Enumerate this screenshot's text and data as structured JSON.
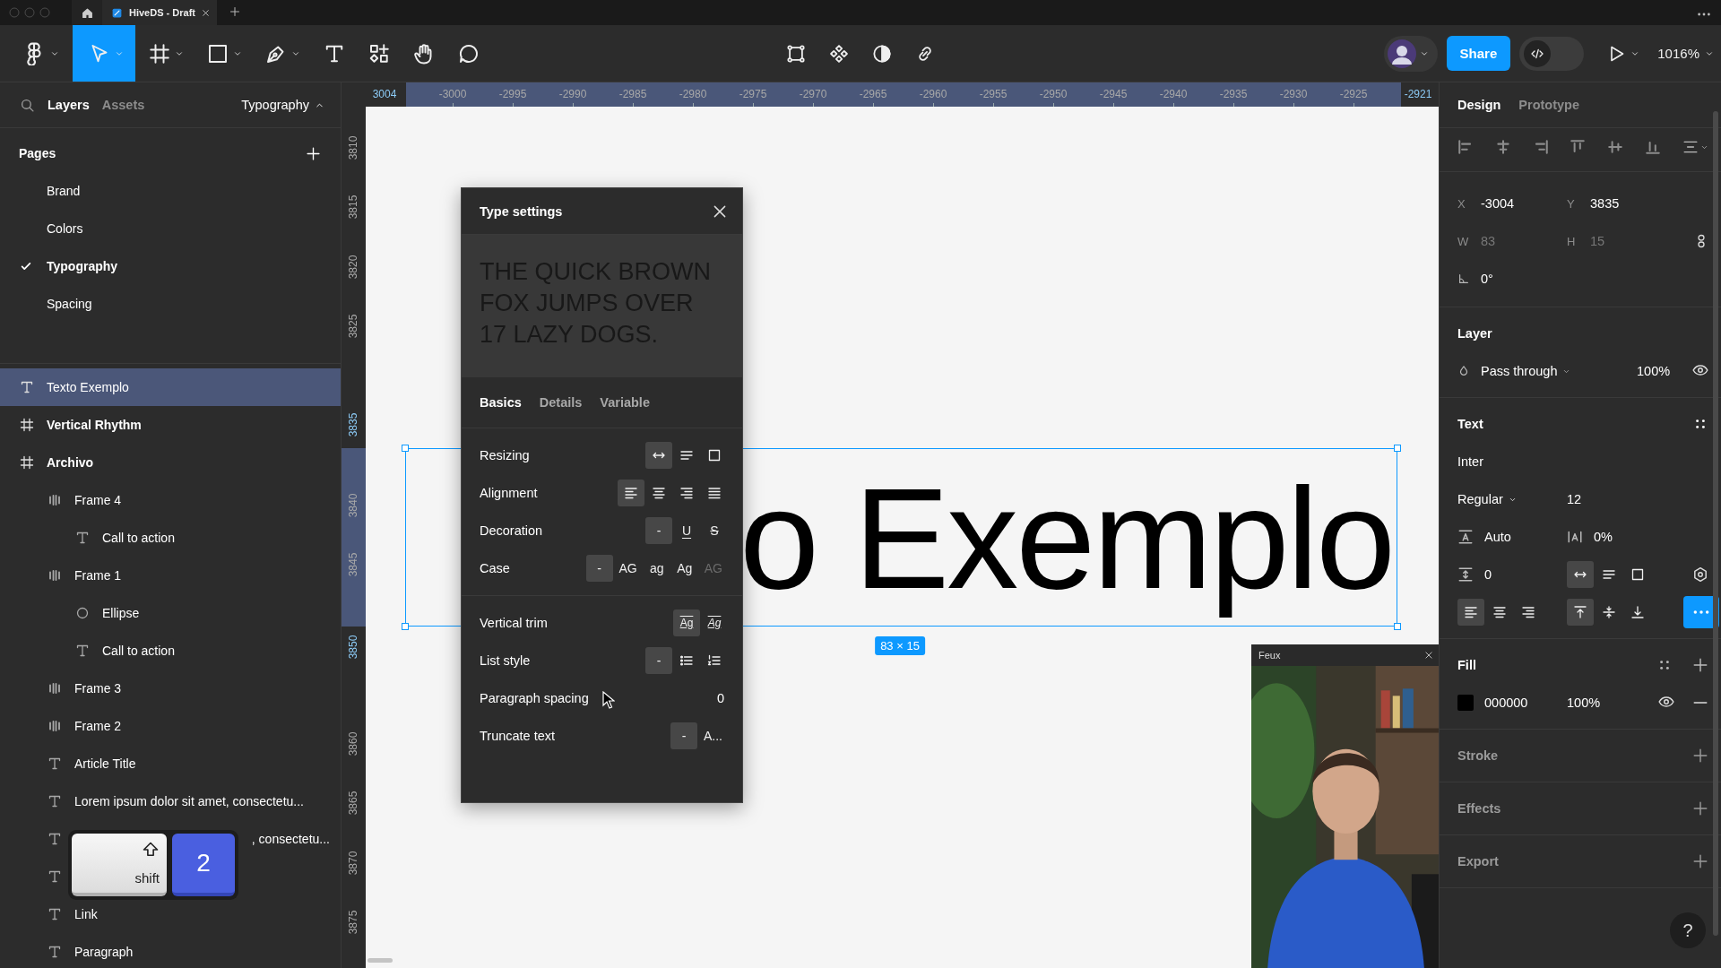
{
  "browser_tabs": [
    {
      "title": "HiveDS - Draft",
      "selected": true
    }
  ],
  "toolbar": {
    "tools": [
      {
        "kind": "figma",
        "selected": false
      },
      {
        "kind": "move",
        "selected": true
      },
      {
        "kind": "frame",
        "selected": false
      },
      {
        "kind": "shape",
        "selected": false
      },
      {
        "kind": "pen",
        "selected": false
      },
      {
        "kind": "text",
        "selected": false
      },
      {
        "kind": "actions",
        "selected": false
      },
      {
        "kind": "hand",
        "selected": false
      },
      {
        "kind": "comment",
        "selected": false
      }
    ],
    "center_tools": [
      {
        "kind": "transform"
      },
      {
        "kind": "component"
      },
      {
        "kind": "contrast"
      },
      {
        "kind": "link"
      }
    ],
    "share": "Share",
    "dev_mode_on": false,
    "zoom": "1016%"
  },
  "left_panel": {
    "tabs": [
      {
        "label": "Layers",
        "selected": true
      },
      {
        "label": "Assets",
        "selected": false
      }
    ],
    "page_picker": "Typography",
    "pages_title": "Pages",
    "pages": [
      {
        "name": "Brand",
        "selected": false
      },
      {
        "name": "Colors",
        "selected": false
      },
      {
        "name": "Typography",
        "selected": true
      },
      {
        "name": "Spacing",
        "selected": false
      }
    ],
    "layers": [
      {
        "name": "Texto Exemplo",
        "kind": "text",
        "selected": true,
        "covered": false
      },
      {
        "name": "Vertical Rhythm",
        "kind": "frame",
        "selected": false,
        "covered": false
      },
      {
        "name": "Archivo",
        "kind": "frame",
        "selected": false,
        "covered": false,
        "children": [
          {
            "name": "Frame 4",
            "kind": "autolayout",
            "selected": false,
            "covered": false,
            "children": [
              {
                "name": "Call to action",
                "kind": "text",
                "selected": false,
                "covered": false
              }
            ]
          },
          {
            "name": "Frame 1",
            "kind": "autolayout",
            "selected": false,
            "covered": false,
            "children": [
              {
                "name": "Ellipse",
                "kind": "ellipse",
                "selected": false,
                "covered": false
              },
              {
                "name": "Call to action",
                "kind": "text",
                "selected": false,
                "covered": false
              }
            ]
          },
          {
            "name": "Frame 3",
            "kind": "autolayout",
            "selected": false,
            "covered": false
          },
          {
            "name": "Frame 2",
            "kind": "autolayout",
            "selected": false,
            "covered": false
          },
          {
            "name": "Article Title",
            "kind": "text",
            "selected": false,
            "covered": false
          },
          {
            "name": "Lorem ipsum dolor sit amet, consectetu...",
            "kind": "text",
            "selected": false,
            "covered": false
          },
          {
            "name": ", consectetu...",
            "kind": "text",
            "selected": false,
            "covered": true
          },
          {
            "kind": "text",
            "selected": false
          },
          {
            "name": "Link",
            "kind": "text",
            "selected": false,
            "covered": false
          },
          {
            "name": "Paragraph",
            "kind": "text",
            "selected": false,
            "covered": false
          }
        ]
      }
    ]
  },
  "key_overlay": {
    "keys": [
      {
        "kind": "modifier",
        "label": "shift"
      },
      {
        "kind": "digit",
        "label": "2"
      }
    ]
  },
  "canvas": {
    "ruler_top": [
      {
        "label": "3004",
        "selected": true
      },
      {
        "label": "-3000",
        "selected": false
      },
      {
        "label": "-2995",
        "selected": false
      },
      {
        "label": "-2990",
        "selected": false
      },
      {
        "label": "-2985",
        "selected": false
      },
      {
        "label": "-2980",
        "selected": false
      },
      {
        "label": "-2975",
        "selected": false
      },
      {
        "label": "-2970",
        "selected": false
      },
      {
        "label": "-2965",
        "selected": false
      },
      {
        "label": "-2960",
        "selected": false
      },
      {
        "label": "-2955",
        "selected": false
      },
      {
        "label": "-2950",
        "selected": false
      },
      {
        "label": "-2945",
        "selected": false
      },
      {
        "label": "-2940",
        "selected": false
      },
      {
        "label": "-2935",
        "selected": false
      },
      {
        "label": "-2930",
        "selected": false
      },
      {
        "label": "-2925",
        "selected": false
      },
      {
        "label": "-2921",
        "selected": true
      }
    ],
    "ruler_left": [
      {
        "label": "3810",
        "selected": false
      },
      {
        "label": "3815",
        "selected": false
      },
      {
        "label": "3820",
        "selected": false
      },
      {
        "label": "3825",
        "selected": false
      },
      {
        "label": "3835",
        "selected": true
      },
      {
        "label": "3840",
        "selected": false
      },
      {
        "label": "3845",
        "selected": false
      },
      {
        "label": "3850",
        "selected": true
      },
      {
        "label": "3860",
        "selected": false
      },
      {
        "label": "3865",
        "selected": false
      },
      {
        "label": "3870",
        "selected": false
      },
      {
        "label": "3875",
        "selected": false
      }
    ],
    "text_end": "o Exemplo",
    "size_badge": "83 × 15"
  },
  "type_settings": {
    "title": "Type settings",
    "preview": "THE QUICK BROWN FOX JUMPS OVER 17 LAZY DOGS.",
    "tabs": [
      {
        "label": "Basics",
        "selected": true
      },
      {
        "label": "Details",
        "selected": false
      },
      {
        "label": "Variable",
        "selected": false
      }
    ],
    "sections": [
      {
        "rows": [
          {
            "label": "Resizing",
            "options": [
              {
                "kind": "hugwidth",
                "selected": true
              },
              {
                "kind": "autoheight",
                "selected": false
              },
              {
                "kind": "fixedsize",
                "selected": false
              }
            ]
          },
          {
            "label": "Alignment",
            "options": [
              {
                "kind": "alignleft",
                "selected": true
              },
              {
                "kind": "aligncenter",
                "selected": false
              },
              {
                "kind": "alignright",
                "selected": false
              },
              {
                "kind": "justify",
                "selected": false
              }
            ]
          },
          {
            "label": "Decoration",
            "options": [
              {
                "kind": "text",
                "label": "-",
                "selected": true
              },
              {
                "kind": "underline",
                "label": "U",
                "selected": false
              },
              {
                "kind": "strike",
                "label": "S",
                "selected": false
              }
            ]
          },
          {
            "label": "Case",
            "options": [
              {
                "kind": "text",
                "label": "-",
                "selected": true,
                "disabled": false
              },
              {
                "kind": "text",
                "label": "AG",
                "selected": false,
                "disabled": false
              },
              {
                "kind": "text",
                "label": "ag",
                "selected": false,
                "disabled": false
              },
              {
                "kind": "text",
                "label": "Ag",
                "selected": false,
                "disabled": false
              },
              {
                "kind": "text",
                "label": "AG",
                "selected": false,
                "disabled": true
              }
            ]
          }
        ]
      },
      {
        "rows": [
          {
            "label": "Vertical trim",
            "options": [
              {
                "kind": "trim",
                "label": "Ag",
                "selected": true
              },
              {
                "kind": "trimcap",
                "label": "Ag",
                "selected": false
              }
            ]
          },
          {
            "label": "List style",
            "options": [
              {
                "kind": "text",
                "label": "-",
                "selected": true
              },
              {
                "kind": "bullets",
                "selected": false
              },
              {
                "kind": "numbers",
                "selected": false
              }
            ]
          },
          {
            "label": "Paragraph spacing",
            "value": "0"
          },
          {
            "label": "Truncate text",
            "options": [
              {
                "kind": "text",
                "label": "-",
                "selected": true
              },
              {
                "kind": "text",
                "label": "A...",
                "selected": false
              }
            ]
          }
        ]
      }
    ]
  },
  "video_overlay": {
    "title": "Feux",
    "kind": "picture"
  },
  "design_panel": {
    "tabs": [
      {
        "label": "Design",
        "selected": true
      },
      {
        "label": "Prototype",
        "selected": false
      }
    ],
    "transform": [
      {
        "label": "X",
        "value": "-3004",
        "disabled": false
      },
      {
        "label": "Y",
        "value": "3835",
        "disabled": false
      },
      {
        "label": "W",
        "value": "83",
        "disabled": true
      },
      {
        "label": "H",
        "value": "15",
        "disabled": true
      }
    ],
    "rotation": "0°",
    "layer": {
      "title": "Layer",
      "blend": "Pass through",
      "opacity": "100%",
      "visible": true
    },
    "text": {
      "title": "Text",
      "font": "Inter",
      "weight": "Regular",
      "size": "12",
      "line_height": "Auto",
      "letter_spacing": "0%",
      "paragraph_spacing": "0",
      "resizing": [
        {
          "kind": "hugwidth",
          "selected": true
        },
        {
          "kind": "autoheight",
          "selected": false
        },
        {
          "kind": "fixedsize",
          "selected": false
        }
      ],
      "align_h": [
        {
          "kind": "alignleft",
          "selected": true
        },
        {
          "kind": "aligncenter",
          "selected": false
        },
        {
          "kind": "alignright",
          "selected": false
        }
      ],
      "align_v": [
        {
          "kind": "top",
          "selected": true
        },
        {
          "kind": "middle",
          "selected": false
        },
        {
          "kind": "bottom",
          "selected": false
        }
      ]
    },
    "fill": {
      "title": "Fill",
      "color": "#000000",
      "hex": "000000",
      "opacity": "100%",
      "visible": true
    },
    "sections": [
      {
        "title": "Stroke"
      },
      {
        "title": "Effects"
      },
      {
        "title": "Export"
      }
    ],
    "help": "?"
  }
}
